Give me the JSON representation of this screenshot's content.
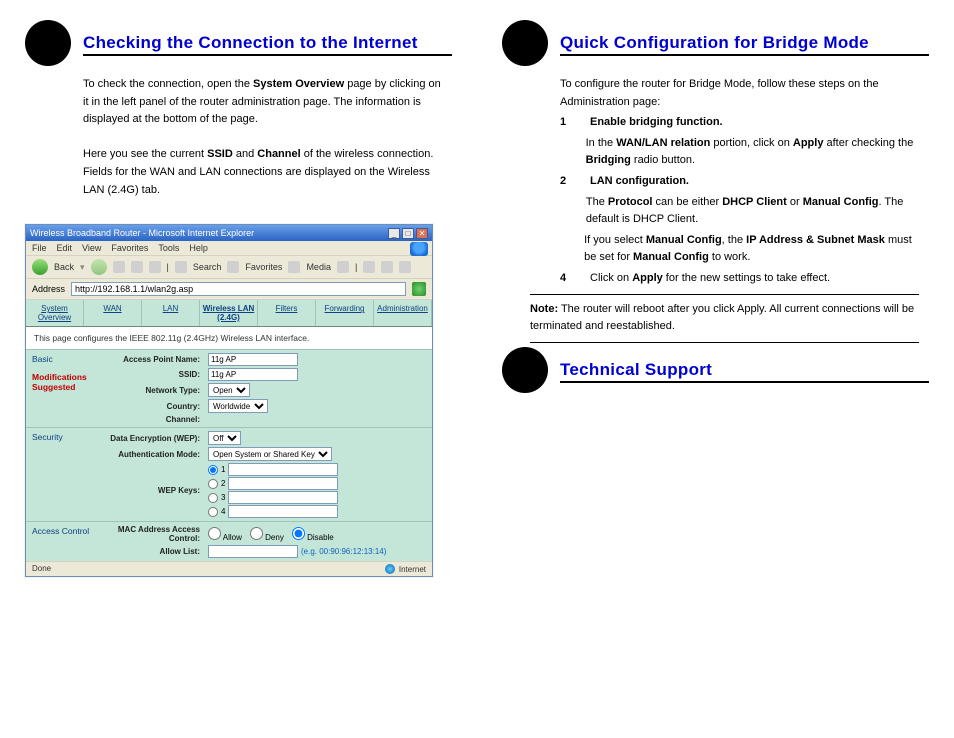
{
  "left": {
    "title": "Checking the Connection to the Internet",
    "body1_prefix": "To check the connection, open the ",
    "body1_bold": "System Overview",
    "body1_suffix": " page by clicking on it in the left panel of the router administration page. The information is displayed at the bottom of the page.",
    "body2_prefix": "Here you see the current ",
    "body2_b1": "SSID",
    "body2_mid": " and ",
    "body2_b2": "Channel",
    "body2_suffix": " of the wireless connection. Fields for the WAN and LAN connections are displayed on the Wireless LAN (2.4G) tab."
  },
  "ie": {
    "title": "Wireless Broadband Router - Microsoft Internet Explorer",
    "menu": [
      "File",
      "Edit",
      "View",
      "Favorites",
      "Tools",
      "Help"
    ],
    "toolbar": {
      "back": "Back",
      "search": "Search",
      "fav": "Favorites",
      "media": "Media"
    },
    "addr_label": "Address",
    "addr": "http://192.168.1.1/wlan2g.asp",
    "tabs": [
      "System Overview",
      "WAN",
      "LAN",
      "Wireless LAN (2.4G)",
      "Filters",
      "Forwarding",
      "Administration"
    ],
    "desc": "This page configures the IEEE 802.11g (2.4GHz) Wireless LAN interface.",
    "sections": {
      "basic": "Basic",
      "mods": "Modifications Suggested",
      "security": "Security",
      "access": "Access Control"
    },
    "fields": {
      "apname_k": "Access Point Name:",
      "apname_v": "11g AP",
      "ssid_k": "SSID:",
      "ssid_v": "11g AP",
      "ntype_k": "Network Type:",
      "ntype_v": "Open",
      "country_k": "Country:",
      "country_v": "Worldwide",
      "channel_k": "Channel:",
      "wep_k": "Data Encryption (WEP):",
      "wep_v": "Off",
      "auth_k": "Authentication Mode:",
      "auth_v": "Open System or Shared Key",
      "keys_k": "WEP Keys:",
      "mac_k": "MAC Address Access Control:",
      "allow": "Allow",
      "deny": "Deny",
      "disable": "Disable",
      "allowlist_k": "Allow List:",
      "eg": "(e.g. 00:90:96:12:13:14)"
    },
    "status_left": "Done",
    "status_right": "Internet"
  },
  "right": {
    "title1": "Quick Configuration for Bridge Mode",
    "intro": "To configure the router for Bridge Mode, follow these steps on the Administration page:",
    "s1_b": "Enable bridging function.",
    "s2_pre": "In the ",
    "s2_b1": "WAN/LAN relation",
    "s2_mid": " portion, click on ",
    "s2_b2": "Apply",
    "s2_mid2": " after checking the ",
    "s2_b3": "Bridging",
    "s2_suf": " radio button.",
    "s3_b": "LAN configuration.",
    "s3b_pre": "The ",
    "s3b_b1": "Protocol",
    "s3b_mid": " can be either ",
    "s3b_b2": "DHCP Client",
    "s3b_mid2": " or ",
    "s3b_b3": "Manual Config",
    "s3b_suf": ". The default is DHCP Client.",
    "s3c_pre": "If you select ",
    "s3c_b1": "Manual Config",
    "s3c_mid": ", the ",
    "s3c_b2": "IP Address & Subnet Mask",
    "s3c_mid2": " must be set for ",
    "s3c_b3": "Manual Config",
    "s3c_suf": " to work.",
    "s4_num": "4",
    "s4_pre": "Click on ",
    "s4_b": "Apply",
    "s4_suf": " for the new settings to take effect.",
    "note_b": "Note:",
    "note_t": " The router will reboot after you click Apply. All current connections will be terminated and reestablished.",
    "title2": "Technical Support"
  }
}
